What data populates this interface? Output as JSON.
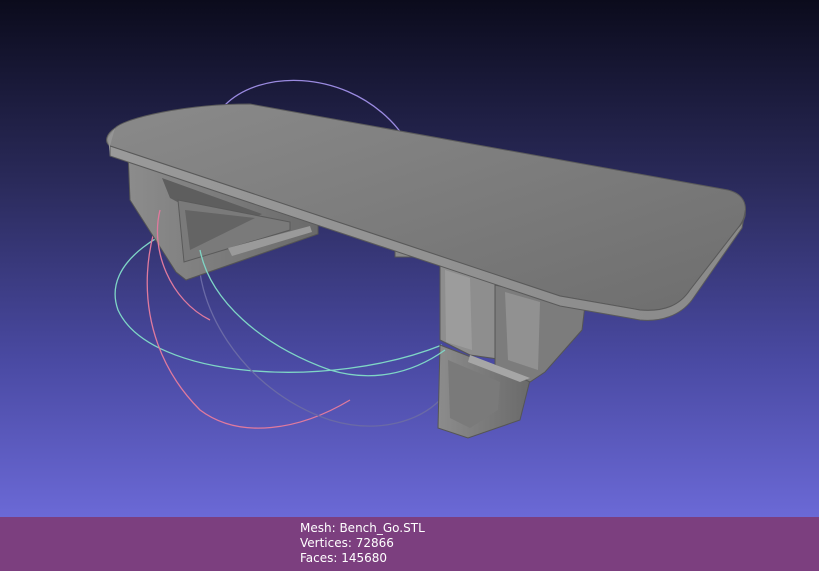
{
  "viewer": {
    "background_top": "#0b0b1c",
    "background_bottom": "#6b69d6",
    "info_bar_color": "#7c3f7f",
    "mesh_color": "#7d7d7d",
    "trackball_colors": [
      "#e07a9e",
      "#9a8ae0",
      "#7fd6c6"
    ]
  },
  "info": {
    "mesh": "Mesh: Bench_Go.STL",
    "vertices": "Vertices: 72866",
    "faces": "Faces: 145680"
  }
}
